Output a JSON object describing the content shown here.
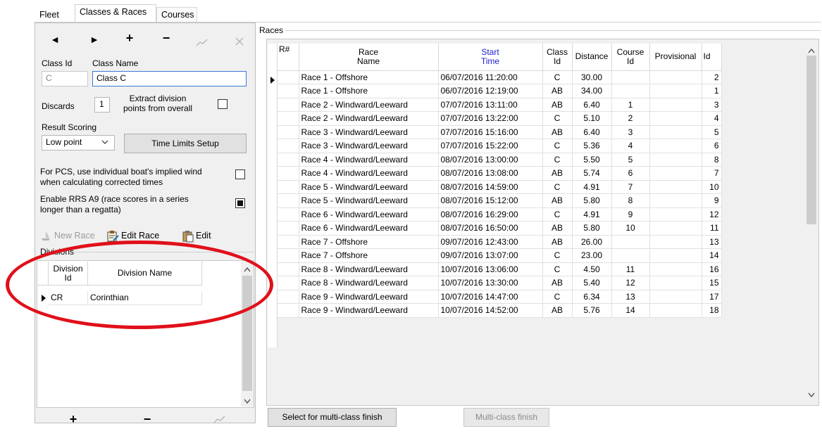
{
  "tabs": [
    {
      "label": "Fleet"
    },
    {
      "label": "Classes & Races"
    },
    {
      "label": "Courses"
    }
  ],
  "class_panel": {
    "nav": [
      "◄",
      "►",
      "+",
      "−"
    ],
    "class_id_label": "Class Id",
    "class_name_label": "Class Name",
    "class_id_value": "C",
    "class_name_value": "Class C",
    "discards_label": "Discards",
    "discards_value": "1",
    "extract_label_1": "Extract division",
    "extract_label_2": "points from overall",
    "result_scoring_label": "Result Scoring",
    "result_scoring_value": "Low point",
    "time_limits_button": "Time Limits Setup",
    "pcs_label_1": "For PCS, use individual boat's implied wind",
    "pcs_label_2": "when calculating corrected times",
    "rrs_label_1": "Enable RRS A9 (race scores in a series",
    "rrs_label_2": "longer than a regatta)",
    "new_race": "New Race",
    "edit_race": "Edit Race",
    "edit": "Edit",
    "divisions_label": "Divisions"
  },
  "divisions": {
    "headers": {
      "id_1": "Division",
      "id_2": "Id",
      "name": "Division Name"
    },
    "rows": [
      {
        "id": "CR",
        "name": "Corinthian"
      }
    ]
  },
  "races": {
    "group_label": "Races",
    "headers": {
      "rnum": "R#",
      "race_name_1": "Race",
      "race_name_2": "Name",
      "start_time_1": "Start",
      "start_time_2": "Time",
      "class_id_1": "Class",
      "class_id_2": "Id",
      "distance": "Distance",
      "course_id_1": "Course",
      "course_id_2": "Id",
      "provisional": "Provisional",
      "id": "Id"
    },
    "rows": [
      {
        "name": "Race 1 - Offshore",
        "start": "06/07/2016 11:20:00",
        "class": "C",
        "distance": "30.00",
        "course": "",
        "id": "2"
      },
      {
        "name": "Race 1 - Offshore",
        "start": "06/07/2016 12:19:00",
        "class": "AB",
        "distance": "34.00",
        "course": "",
        "id": "1"
      },
      {
        "name": "Race 2 - Windward/Leeward",
        "start": "07/07/2016 13:11:00",
        "class": "AB",
        "distance": "6.40",
        "course": "1",
        "id": "3"
      },
      {
        "name": "Race 2 - Windward/Leeward",
        "start": "07/07/2016 13:22:00",
        "class": "C",
        "distance": "5.10",
        "course": "2",
        "id": "4"
      },
      {
        "name": "Race 3 - Windward/Leeward",
        "start": "07/07/2016 15:16:00",
        "class": "AB",
        "distance": "6.40",
        "course": "3",
        "id": "5"
      },
      {
        "name": "Race 3 - Windward/Leeward",
        "start": "07/07/2016 15:22:00",
        "class": "C",
        "distance": "5.36",
        "course": "4",
        "id": "6"
      },
      {
        "name": "Race 4 - Windward/Leeward",
        "start": "08/07/2016 13:00:00",
        "class": "C",
        "distance": "5.50",
        "course": "5",
        "id": "8"
      },
      {
        "name": "Race 4 - Windward/Leeward",
        "start": "08/07/2016 13:08:00",
        "class": "AB",
        "distance": "5.74",
        "course": "6",
        "id": "7"
      },
      {
        "name": "Race 5 - Windward/Leeward",
        "start": "08/07/2016 14:59:00",
        "class": "C",
        "distance": "4.91",
        "course": "7",
        "id": "10"
      },
      {
        "name": "Race 5 - Windward/Leeward",
        "start": "08/07/2016 15:12:00",
        "class": "AB",
        "distance": "5.80",
        "course": "8",
        "id": "9"
      },
      {
        "name": "Race 6 - Windward/Leeward",
        "start": "08/07/2016 16:29:00",
        "class": "C",
        "distance": "4.91",
        "course": "9",
        "id": "12"
      },
      {
        "name": "Race 6 - Windward/Leeward",
        "start": "08/07/2016 16:50:00",
        "class": "AB",
        "distance": "5.80",
        "course": "10",
        "id": "11"
      },
      {
        "name": "Race 7 - Offshore",
        "start": "09/07/2016 12:43:00",
        "class": "AB",
        "distance": "26.00",
        "course": "",
        "id": "13"
      },
      {
        "name": "Race 7 - Offshore",
        "start": "09/07/2016 13:07:00",
        "class": "C",
        "distance": "23.00",
        "course": "",
        "id": "14"
      },
      {
        "name": "Race 8 - Windward/Leeward",
        "start": "10/07/2016 13:06:00",
        "class": "C",
        "distance": "4.50",
        "course": "11",
        "id": "16"
      },
      {
        "name": "Race 8 - Windward/Leeward",
        "start": "10/07/2016 13:30:00",
        "class": "AB",
        "distance": "5.40",
        "course": "12",
        "id": "15"
      },
      {
        "name": "Race 9 - Windward/Leeward",
        "start": "10/07/2016 14:47:00",
        "class": "C",
        "distance": "6.34",
        "course": "13",
        "id": "17"
      },
      {
        "name": "Race 9 - Windward/Leeward",
        "start": "10/07/2016 14:52:00",
        "class": "AB",
        "distance": "5.76",
        "course": "14",
        "id": "18"
      }
    ],
    "select_multi_button": "Select for multi-class finish",
    "multi_finish_button": "Multi-class finish"
  },
  "icons": {
    "prev": "triangle-left-icon",
    "next": "triangle-right-icon",
    "add": "plus-icon",
    "remove": "minus-icon",
    "annotation": "red-ellipse-highlight"
  },
  "colors": {
    "highlight": "#e0101a",
    "header_blue": "#1c1ccf",
    "focus": "#3b78d8"
  }
}
